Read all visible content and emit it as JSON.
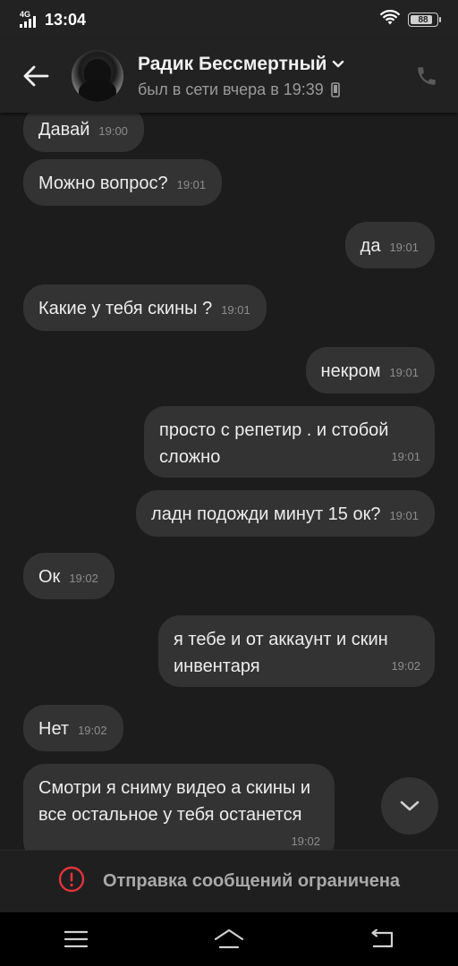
{
  "status_bar": {
    "network": "4G",
    "time": "13:04",
    "battery": "88",
    "battery_level": 0.88
  },
  "header": {
    "contact_name": "Радик Бессмертный",
    "contact_status": "был в сети вчера в 19:39"
  },
  "messages": [
    {
      "direction": "in",
      "text": "Давай",
      "time": "19:00"
    },
    {
      "direction": "in",
      "text": "Можно вопрос?",
      "time": "19:01"
    },
    {
      "direction": "out",
      "text": "да",
      "time": "19:01"
    },
    {
      "direction": "in",
      "text": "Какие у тебя скины ?",
      "time": "19:01"
    },
    {
      "direction": "out",
      "text": "некром",
      "time": "19:01"
    },
    {
      "direction": "out",
      "text": "просто с репетир . и стобой сложно",
      "time": "19:01"
    },
    {
      "direction": "out",
      "text": "ладн подожди минут 15 ок?",
      "time": "19:01"
    },
    {
      "direction": "in",
      "text": "Ок",
      "time": "19:02"
    },
    {
      "direction": "out",
      "text": "я тебе и от аккаунт и скин инвентаря",
      "time": "19:02"
    },
    {
      "direction": "in",
      "text": "Нет",
      "time": "19:02"
    },
    {
      "direction": "in",
      "text": "Смотри я сниму видео а скины и все остальное у тебя останется",
      "time": "19:02"
    }
  ],
  "restriction": {
    "text": "Отправка сообщений ограничена",
    "icon": "alert-circle-icon",
    "color": "#e2333d"
  },
  "colors": {
    "background": "#1c1c1c",
    "header": "#222222",
    "bubble": "#333333"
  }
}
